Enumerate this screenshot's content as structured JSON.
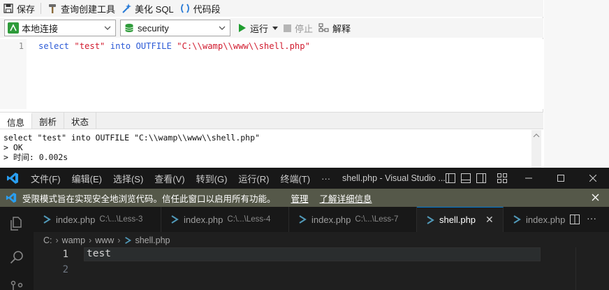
{
  "navicat": {
    "toolbar": {
      "save_label": "保存",
      "query_builder_label": "查询创建工具",
      "beautify_label": "美化 SQL",
      "snippet_label": "代码段"
    },
    "connection_value": "本地连接",
    "database_value": "security",
    "run_label": "运行",
    "stop_label": "停止",
    "explain_label": "解释",
    "editor": {
      "line_number": "1",
      "tokens": {
        "select": "select",
        "str1": "\"test\"",
        "into": "into",
        "outfile": "OUTFILE",
        "path": "\"C:\\\\wamp\\\\www\\\\shell.php\""
      }
    },
    "result_tabs": [
      "信息",
      "剖析",
      "状态"
    ],
    "info_lines": [
      "select \"test\" into OUTFILE \"C:\\\\wamp\\\\www\\\\shell.php\"",
      "> OK",
      "> 时间: 0.002s"
    ]
  },
  "vscode": {
    "menu": [
      "文件(F)",
      "编辑(E)",
      "选择(S)",
      "查看(V)",
      "转到(G)",
      "运行(R)",
      "终端(T)",
      "···"
    ],
    "window_title": "shell.php - Visual Studio ...",
    "banner": {
      "text": "受限模式旨在实现安全地浏览代码。信任此窗口以启用所有功能。",
      "manage": "管理",
      "learn_more": "了解详细信息"
    },
    "tabs": [
      {
        "name": "index.php",
        "path": "C:\\...\\Less-3"
      },
      {
        "name": "index.php",
        "path": "C:\\...\\Less-4"
      },
      {
        "name": "index.php",
        "path": "C:\\...\\Less-7"
      },
      {
        "name": "shell.php",
        "path": ""
      },
      {
        "name": "index.php",
        "path": ""
      }
    ],
    "breadcrumbs": [
      "C:",
      "wamp",
      "www",
      "shell.php"
    ],
    "lines": [
      {
        "num": "1",
        "text": "test"
      },
      {
        "num": "2",
        "text": ""
      }
    ],
    "colors": {
      "accent": "#0078d4",
      "banner_bg": "#555849"
    }
  }
}
